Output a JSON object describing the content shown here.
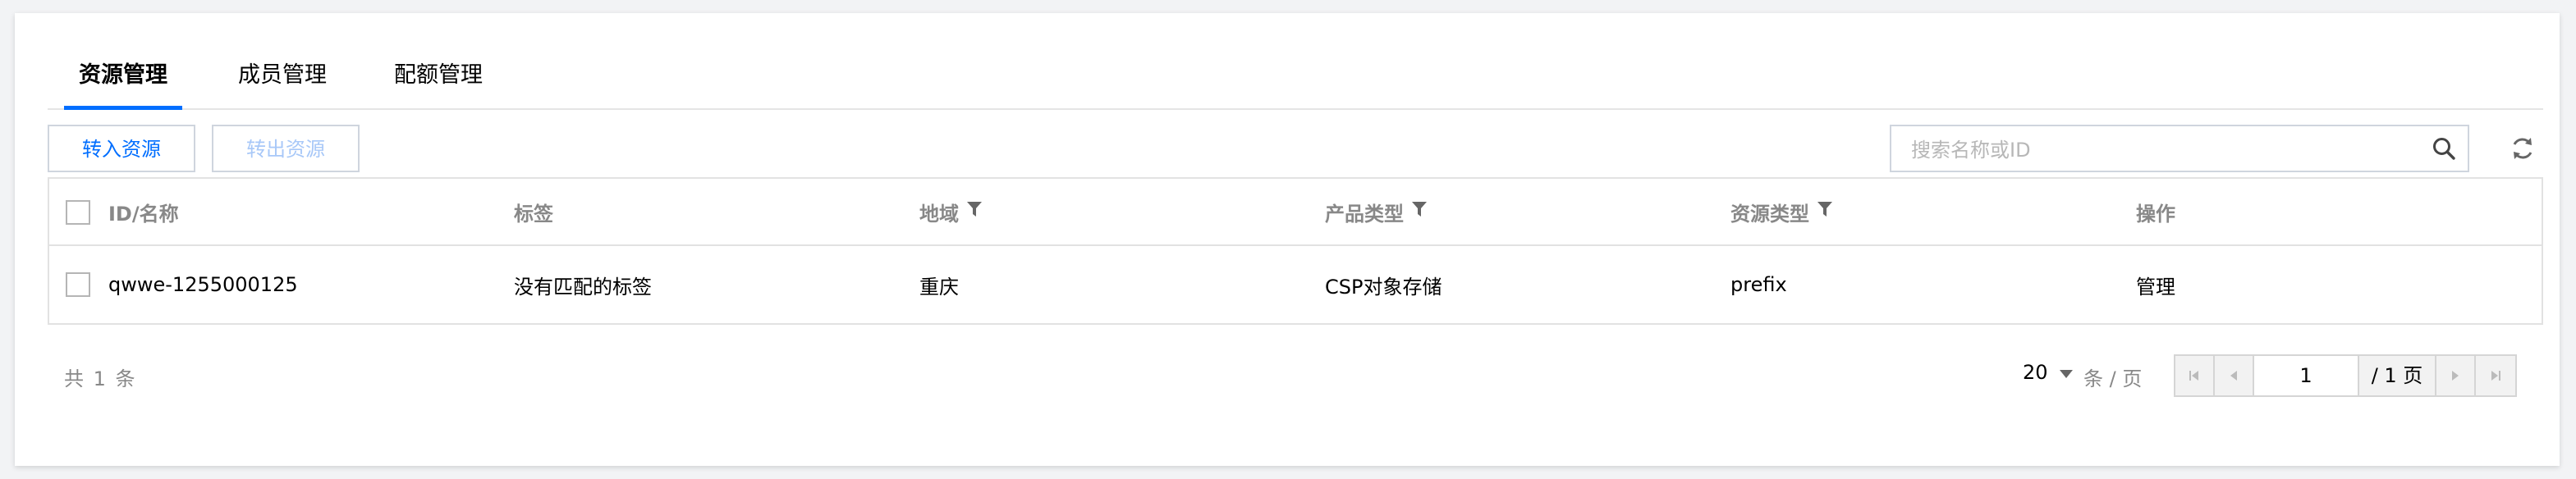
{
  "tabs": [
    {
      "label": "资源管理",
      "active": true
    },
    {
      "label": "成员管理",
      "active": false
    },
    {
      "label": "配额管理",
      "active": false
    }
  ],
  "toolbar": {
    "transfer_in_label": "转入资源",
    "transfer_out_label": "转出资源"
  },
  "search": {
    "placeholder": "搜索名称或ID",
    "value": ""
  },
  "table": {
    "columns": [
      "ID/名称",
      "标签",
      "地域",
      "产品类型",
      "资源类型",
      "操作"
    ],
    "filterable_columns": [
      "地域",
      "产品类型",
      "资源类型"
    ],
    "rows": [
      {
        "id_name": "qwwe-1255000125",
        "tag": "没有匹配的标签",
        "region": "重庆",
        "product_type": "CSP对象存储",
        "resource_type": "prefix",
        "action": "管理"
      }
    ]
  },
  "footer": {
    "total_text": "共 1 条",
    "page_size": "20",
    "per_page_text": "条 / 页",
    "current_page": "1",
    "total_pages_text": "/ 1 页"
  },
  "colors": {
    "accent": "#006eff",
    "disabled_text": "#a8c8f8",
    "muted_text": "#888888",
    "border": "#e2e2e2"
  },
  "icons": {
    "search": "search-icon",
    "refresh": "refresh-icon",
    "filter": "filter-icon",
    "first_page": "first-page-icon",
    "prev_page": "prev-page-icon",
    "next_page": "next-page-icon",
    "last_page": "last-page-icon"
  }
}
